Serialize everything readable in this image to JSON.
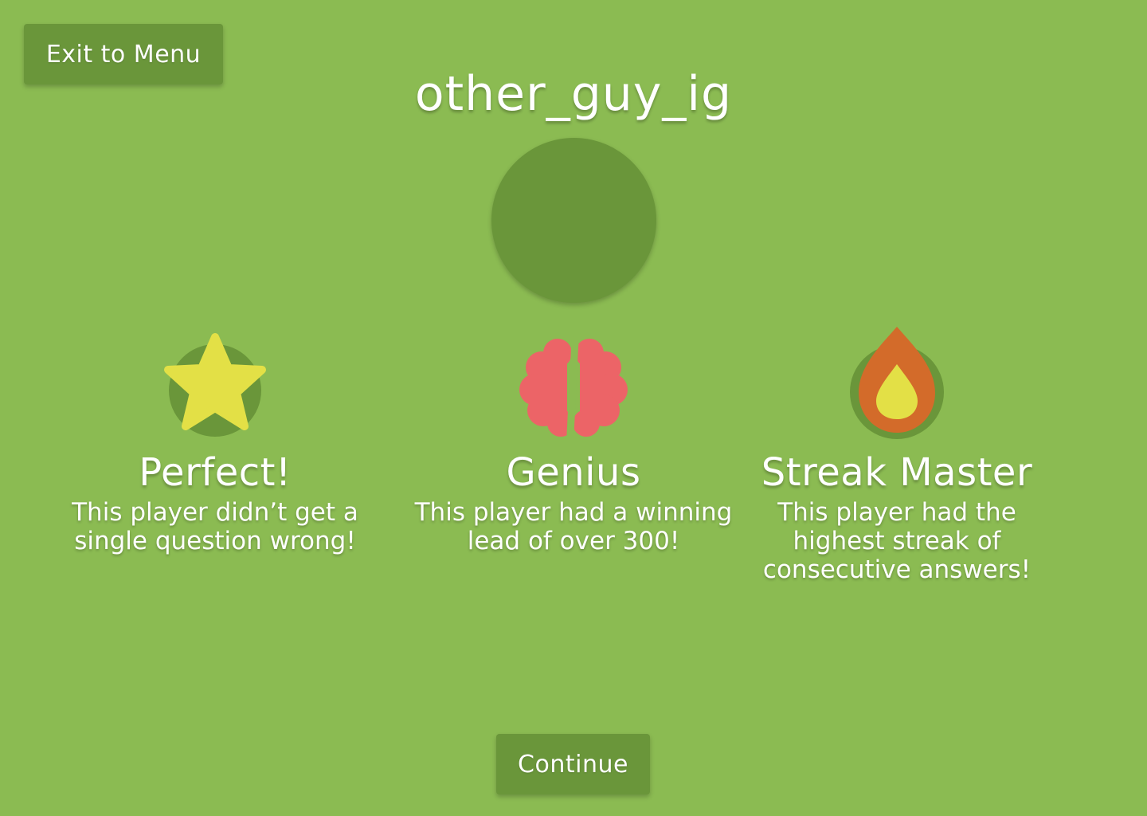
{
  "header": {
    "exit_label": "Exit to Menu",
    "player_name": "other_guy_ig"
  },
  "awards": [
    {
      "icon": "star-icon",
      "title": "Perfect!",
      "description": "This player didn’t get a single question wrong!"
    },
    {
      "icon": "brain-icon",
      "title": "Genius",
      "description": "This player had a winning lead of over 300!"
    },
    {
      "icon": "flame-icon",
      "title": "Streak Master",
      "description": "This player had the highest streak of consecutive answers!"
    }
  ],
  "footer": {
    "continue_label": "Continue"
  },
  "colors": {
    "background": "#8bbb52",
    "button": "#6a963a",
    "star": "#e3e046",
    "brain": "#ec6467",
    "flame_outer": "#d36b2a",
    "flame_inner": "#e3e046"
  }
}
